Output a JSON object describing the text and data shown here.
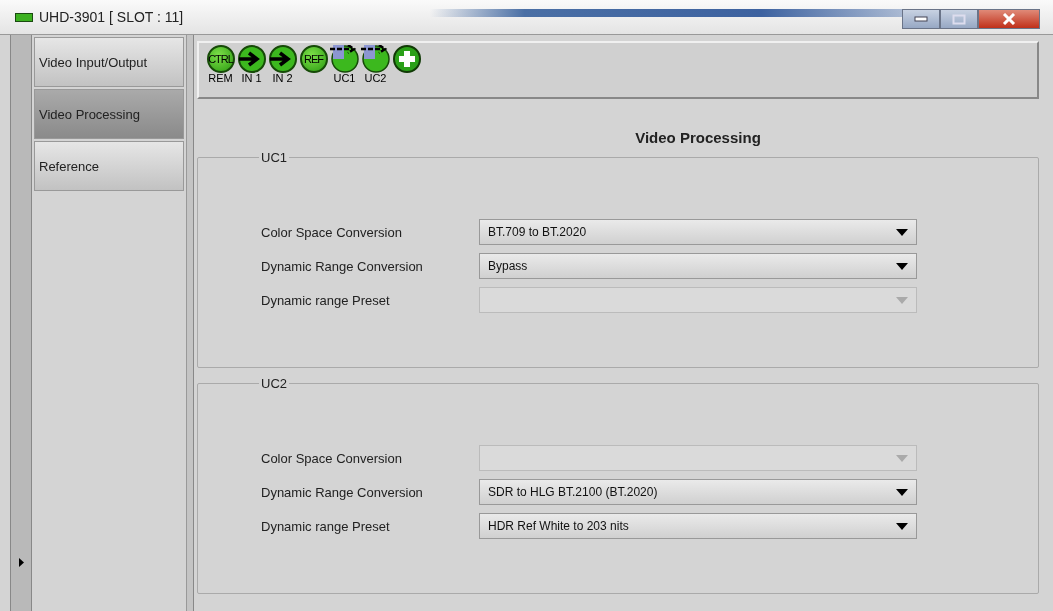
{
  "window": {
    "title": "UHD-3901 [ SLOT : 11]"
  },
  "sidebar": {
    "items": [
      {
        "label": "Video Input/Output",
        "selected": false
      },
      {
        "label": "Video Processing",
        "selected": true
      },
      {
        "label": "Reference",
        "selected": false
      }
    ]
  },
  "toolbar": {
    "items": [
      {
        "kind": "text",
        "text": "CTRL",
        "label": "REM"
      },
      {
        "kind": "arrow",
        "label": "IN 1"
      },
      {
        "kind": "arrow",
        "label": "IN 2"
      },
      {
        "kind": "text",
        "text": "REF"
      },
      {
        "kind": "uc",
        "label": "UC1"
      },
      {
        "kind": "uc",
        "label": "UC2"
      },
      {
        "kind": "plus"
      }
    ]
  },
  "page_title": "Video Processing",
  "groups": [
    {
      "title": "UC1",
      "rows": [
        {
          "label": "Color Space Conversion",
          "value": "BT.709 to BT.2020",
          "disabled": false
        },
        {
          "label": "Dynamic Range Conversion",
          "value": "Bypass",
          "disabled": false
        },
        {
          "label": "Dynamic range Preset",
          "disabled": true
        }
      ]
    },
    {
      "title": "UC2",
      "rows": [
        {
          "label": "Color Space Conversion",
          "disabled": true
        },
        {
          "label": "Dynamic Range Conversion",
          "value": "SDR to HLG BT.2100 (BT.2020)",
          "disabled": false
        },
        {
          "label": "Dynamic range Preset",
          "value": "HDR Ref White to 203 nits",
          "disabled": false
        }
      ]
    }
  ]
}
